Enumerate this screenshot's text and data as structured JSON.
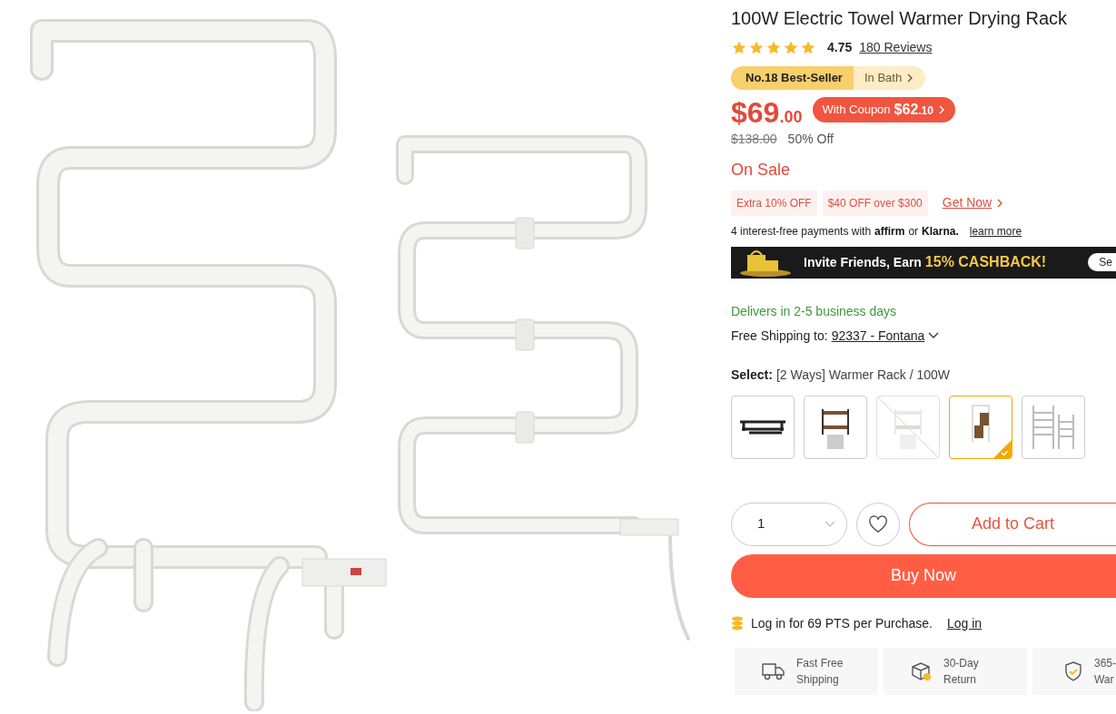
{
  "title": "100W Electric Towel Warmer Drying Rack",
  "rating": {
    "stars": 5,
    "score": "4.75",
    "reviews": "180 Reviews"
  },
  "rank": {
    "badge": "No.18 Best-Seller",
    "category": "In Bath"
  },
  "price": {
    "main": "$69",
    "cents": ".00",
    "coupon_label": "With Coupon",
    "coupon_price": "$62",
    "coupon_cents": ".10",
    "original": "$138.00",
    "discount": "50% Off"
  },
  "sale_label": "On Sale",
  "promos": [
    "Extra 10% OFF",
    "$40 OFF over $300"
  ],
  "get_now": "Get Now",
  "installments": {
    "text": "4 interest-free payments with",
    "affirm": "affirm",
    "or": "or",
    "klarna": "Klarna.",
    "link": "learn more"
  },
  "banner": {
    "text": "Invite Friends, Earn",
    "highlight": "15% CASHBACK!",
    "button": "Se"
  },
  "delivery": "Delivers in 2-5 business days",
  "shipping": {
    "label": "Free Shipping to:",
    "location": "92337 - Fontana"
  },
  "select": {
    "label": "Select:",
    "value": "[2 Ways] Warmer Rack / 100W"
  },
  "variants": [
    {
      "kind": "black-shelf",
      "selected": false,
      "disabled": false
    },
    {
      "kind": "wood-shelf",
      "selected": false,
      "disabled": false
    },
    {
      "kind": "white-shelf",
      "selected": false,
      "disabled": true
    },
    {
      "kind": "wall-rack",
      "selected": true,
      "disabled": false
    },
    {
      "kind": "ladder-rack",
      "selected": false,
      "disabled": false
    }
  ],
  "quantity": "1",
  "add_to_cart": "Add to Cart",
  "buy_now": "Buy Now",
  "points": {
    "text": "Log in for 69 PTS per Purchase.",
    "link": "Log in"
  },
  "features": [
    {
      "kind": "truck",
      "lines": [
        "Fast Free",
        "Shipping"
      ]
    },
    {
      "kind": "box",
      "lines": [
        "30-Day",
        "Return"
      ]
    },
    {
      "kind": "shield",
      "lines": [
        "365-",
        "War"
      ]
    }
  ]
}
